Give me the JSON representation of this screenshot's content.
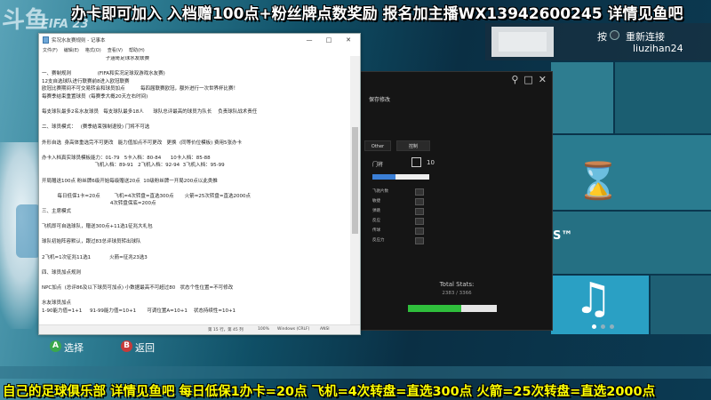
{
  "banner": {
    "top": "办卡即可加入 入档赠100点+粉丝牌点数奖励 报名加主播WX13942600245 详情见鱼吧",
    "bottom": "自己的足球俱乐部 详情见鱼吧 每日低保1办卡=20点 飞机=4次转盘=直选300点 火箭=25次转盘=直选2000点"
  },
  "logo": {
    "main": "斗鱼",
    "sub": "FIFA 23"
  },
  "user": {
    "key_label": "按",
    "reconnect_label": "重新连接",
    "name": "liuzihan24"
  },
  "tiles": {
    "ts_label": "S™"
  },
  "controls": {
    "select_key": "A",
    "select_label": "选择",
    "back_key": "B",
    "back_label": "返回"
  },
  "overlay": {
    "save_label": "保存修改",
    "tabs": [
      "Other",
      "控制"
    ],
    "row_label": "门将",
    "row_value": "10",
    "slider_fraction": 0.4,
    "items": [
      "飞驰片数",
      "敏捷",
      "弹跳",
      "反应",
      "传球",
      "反应力"
    ],
    "total_label": "Total Stats:",
    "total_value": "2383 / 3366",
    "progress_fraction": 0.6
  },
  "notepad": {
    "title": "实况水友赛规则 - 记事本",
    "menu": [
      "文件(F)",
      "编辑(E)",
      "格式(O)",
      "查看(V)",
      "帮助(H)"
    ],
    "lines": [
      "                                         子涵哥足球水友联赛",
      "",
      "一、赛制规则                 (FIFA和实况足球双游戏水友赛)",
      "12支自选球队进行联赛前8进入欧冠联赛",
      "欧冠比赛期间不可交易转会和球员加点          每四届联赛欧冠，额外进行一次世界杯比赛！",
      "每赛季结束重置球员  (每赛季大概20天左右时间)",
      "",
      "每支球队最多2名水友球员   每支球队最多18人      球队总评最高的球员为队长    负责球队战术责任",
      "",
      "二、球员模式：   (赛季结束强制退役) 门将不可选",
      "",
      "外形自选  身高体重选完不可更改   能力值加点不可更改   更换  (同等价位模板) 费用5张办卡",
      "",
      "办卡入档真实球员模板能力：01-79   5卡入档：80-84      10卡入档：85-88",
      "                                  飞机入档：89-91   2飞机入档：92-94  3飞机入档：95-99",
      "",
      "开局赠送100点 粉丝牌6级开始每级赠送20点  10级粉丝牌一开局200点以此类推",
      "",
      "          每日低保1卡=20点         飞机=4次转盘=直选300点       火箭=25次转盘=直选2000点",
      "                                            4次转盘保底=200点",
      "三、主席模式",
      "",
      "飞机即可自选球队，赠送300点+11选1征兆大礼包",
      "",
      "球队初始阵容默认，跟过83总评球员转出球队",
      "",
      "2飞机=1次征兆11选1            火箭=征兆23选3",
      "",
      "四、球员加点规则",
      "",
      "NPC加点  (总评86及以下球员可加点) 小数据最高不可超过80   状态个性位置=不可修改",
      "",
      "水友球员加点",
      "1-90能力值=1+1     91-99能力值=10+1       可调位置A=10+1    状态持续性=10+1"
    ],
    "status": [
      "第 15 行，第 45 列",
      "100%",
      "Windows (CRLF)",
      "ANSI"
    ]
  }
}
